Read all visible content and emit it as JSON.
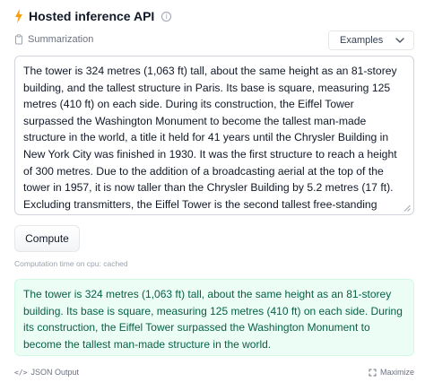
{
  "header": {
    "title": "Hosted inference API",
    "bolt_color": "#f59e0b",
    "info_icon": "info-icon"
  },
  "task": {
    "label": "Summarization",
    "icon": "clipboard-icon"
  },
  "examples": {
    "label": "Examples",
    "icon": "chevron-down-icon"
  },
  "input": {
    "value": "The tower is 324 metres (1,063 ft) tall, about the same height as an 81-storey building, and the tallest structure in Paris. Its base is square, measuring 125 metres (410 ft) on each side. During its construction, the Eiffel Tower surpassed the Washington Monument to become the tallest man-made structure in the world, a title it held for 41 years until the Chrysler Building in New York City was finished in 1930. It was the first structure to reach a height of 300 metres. Due to the addition of a broadcasting aerial at the top of the tower in 1957, it is now taller than the Chrysler Building by 5.2 metres (17 ft). Excluding transmitters, the Eiffel Tower is the second tallest free-standing structure in France after the Millau Viaduct."
  },
  "compute": {
    "label": "Compute"
  },
  "computation_time": "Computation time on cpu: cached",
  "output": {
    "text": "The tower is 324 metres (1,063 ft) tall, about the same height as an 81-storey building. Its base is square, measuring 125 metres (410 ft) on each side. During its construction, the Eiffel Tower surpassed the Washington Monument to become the tallest man-made structure in the world.",
    "bg_color": "#ecfdf5",
    "text_color": "#065f46"
  },
  "footer": {
    "json_output_label": "JSON Output",
    "json_icon": "code-icon",
    "maximize_label": "Maximize",
    "maximize_icon": "maximize-icon"
  }
}
